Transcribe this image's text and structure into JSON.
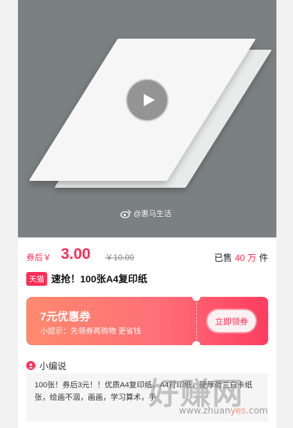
{
  "media": {
    "watermark_text": "@惠马生活",
    "play_icon": "play-icon",
    "weibo_icon": "weibo-icon"
  },
  "price": {
    "label": "券后￥",
    "value": "3.00",
    "original": "￥10.00",
    "sold_prefix": "已售",
    "sold_count": "40 万",
    "sold_suffix": "件"
  },
  "product": {
    "badge": "天猫",
    "title": "速抢！100张A4复印纸"
  },
  "coupon": {
    "amount": "7元优惠券",
    "tip": "小提示：先领券再购物 更省钱",
    "button_label": "立即领券"
  },
  "editor": {
    "title": "小编说",
    "text": "100张！券后3元！！优质A4复印纸，A4打印纸，硬厚荷兰白卡纸张，绘画不洇，画画，学习算术，手",
    "icon": "editor-icon"
  },
  "site_watermark": {
    "big": "好赚网",
    "url_prefix": "www.zhuan",
    "url_highlight": "yes",
    "url_suffix": ".com"
  },
  "colors": {
    "accent": "#ff2d55",
    "media_bg": "#7b8183",
    "coupon_start": "#ff8a6e",
    "coupon_end": "#ff3c5f"
  }
}
